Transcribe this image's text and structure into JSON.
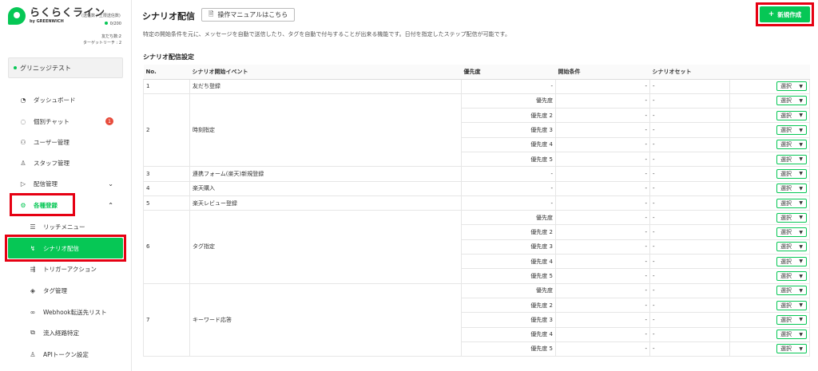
{
  "brand": {
    "title": "らくらくライン",
    "subtitle": "by GREENWICH",
    "tag": "(送信数 / 上限送信数)",
    "send_count": "0/200",
    "friends_label": "友だち数:2",
    "target_label": "ターゲットリーチ : 2"
  },
  "account": {
    "name": "グリニッジテスト"
  },
  "nav": {
    "dashboard": "ダッシュボード",
    "chat": "個別チャット",
    "chat_badge": "1",
    "users": "ユーザー管理",
    "staff": "スタッフ管理",
    "delivery": "配信管理",
    "registration": "各種登録",
    "richmenu": "リッチメニュー",
    "scenario": "シナリオ配信",
    "trigger": "トリガーアクション",
    "tags": "タグ管理",
    "webhook": "Webhook転送先リスト",
    "route": "流入経路特定",
    "api": "APIトークン設定"
  },
  "header": {
    "title": "シナリオ配信",
    "manual_button": "操作マニュアルはこちら",
    "new_button": "新規作成",
    "description": "特定の開始条件を元に、メッセージを自動で送信したり、タグを自動で付与することが出来る機能です。日付を指定したステップ配信が可能です。"
  },
  "section": {
    "title": "シナリオ配信設定"
  },
  "table": {
    "headers": [
      "No.",
      "シナリオ開始イベント",
      "優先度",
      "開始条件",
      "シナリオセット",
      ""
    ],
    "select_label": "選択",
    "dash": "-",
    "groups": [
      {
        "no": "1",
        "event": "友だち登録",
        "rows": [
          "-"
        ]
      },
      {
        "no": "2",
        "event": "時刻指定",
        "rows": [
          "優先度",
          "優先度 2",
          "優先度 3",
          "優先度 4",
          "優先度 5"
        ]
      },
      {
        "no": "3",
        "event": "連携フォーム(楽天)新規登録",
        "rows": [
          "-"
        ]
      },
      {
        "no": "4",
        "event": "楽天購入",
        "rows": [
          "-"
        ]
      },
      {
        "no": "5",
        "event": "楽天レビュー登録",
        "rows": [
          "-"
        ]
      },
      {
        "no": "6",
        "event": "タグ指定",
        "rows": [
          "優先度",
          "優先度 2",
          "優先度 3",
          "優先度 4",
          "優先度 5"
        ]
      },
      {
        "no": "7",
        "event": "キーワード応答",
        "rows": [
          "優先度",
          "優先度 2",
          "優先度 3",
          "優先度 4",
          "優先度 5"
        ]
      }
    ]
  },
  "colors": {
    "accent": "#06c755",
    "highlight": "#e60012",
    "badge": "#e74c3c"
  }
}
